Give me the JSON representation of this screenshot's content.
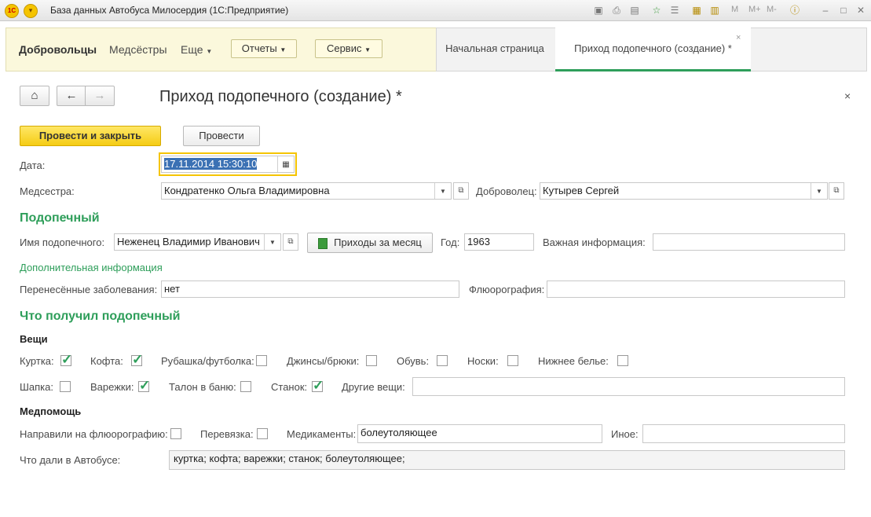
{
  "window": {
    "title": "База данных Автобуса Милосердия  (1С:Предприятие)"
  },
  "nav": {
    "links": [
      "Добровольцы",
      "Медсёстры",
      "Еще"
    ],
    "buttons": [
      "Отчеты",
      "Сервис"
    ]
  },
  "tabs": [
    "Начальная страница",
    "Приход подопечного (создание) *"
  ],
  "form": {
    "title": "Приход подопечного (создание) *",
    "post_close_label": "Провести и закрыть",
    "post_label": "Провести",
    "date_label": "Дата:",
    "date_value": "17.11.2014 15:30:10",
    "nurse_label": "Медсестра:",
    "nurse_value": "Кондратенко Ольга Владимировна",
    "volunteer_label": "Доброволец:",
    "volunteer_value": "Кутырев Сергей"
  },
  "ward": {
    "section": "Подопечный",
    "name_label": "Имя подопечного:",
    "name_value": "Неженец Владимир Иванович",
    "monthly_button": "Приходы за месяц",
    "year_label": "Год:",
    "year_value": "1963",
    "important_label": "Важная информация:",
    "important_value": "",
    "extra_link": "Дополнительная информация",
    "diseases_label": "Перенесённые заболевания:",
    "diseases_value": "нет",
    "xray_label": "Флюорография:",
    "xray_value": ""
  },
  "received": {
    "section": "Что получил подопечный",
    "things_group": "Вещи",
    "things": [
      {
        "label": "Куртка:",
        "checked": true
      },
      {
        "label": "Кофта:",
        "checked": true
      },
      {
        "label": "Рубашка/футболка:",
        "checked": false
      },
      {
        "label": "Джинсы/брюки:",
        "checked": false
      },
      {
        "label": "Обувь:",
        "checked": false
      },
      {
        "label": "Носки:",
        "checked": false
      },
      {
        "label": "Нижнее белье:",
        "checked": false
      },
      {
        "label": "Шапка:",
        "checked": false
      },
      {
        "label": "Варежки:",
        "checked": true
      },
      {
        "label": "Талон в баню:",
        "checked": false
      },
      {
        "label": "Станок:",
        "checked": true
      }
    ],
    "other_label": "Другие вещи:",
    "other_value": "",
    "med_group": "Медпомощь",
    "xray_sent_label": "Направили на флюорографию:",
    "xray_sent_checked": false,
    "bandage_label": "Перевязка:",
    "bandage_checked": false,
    "meds_label": "Медикаменты:",
    "meds_value": "болеутоляющее",
    "misc_label": "Иное:",
    "misc_value": "",
    "given_label": "Что дали в Автобусе:",
    "given_value": "куртка; кофта; варежки; станок; болеутоляющее;"
  }
}
